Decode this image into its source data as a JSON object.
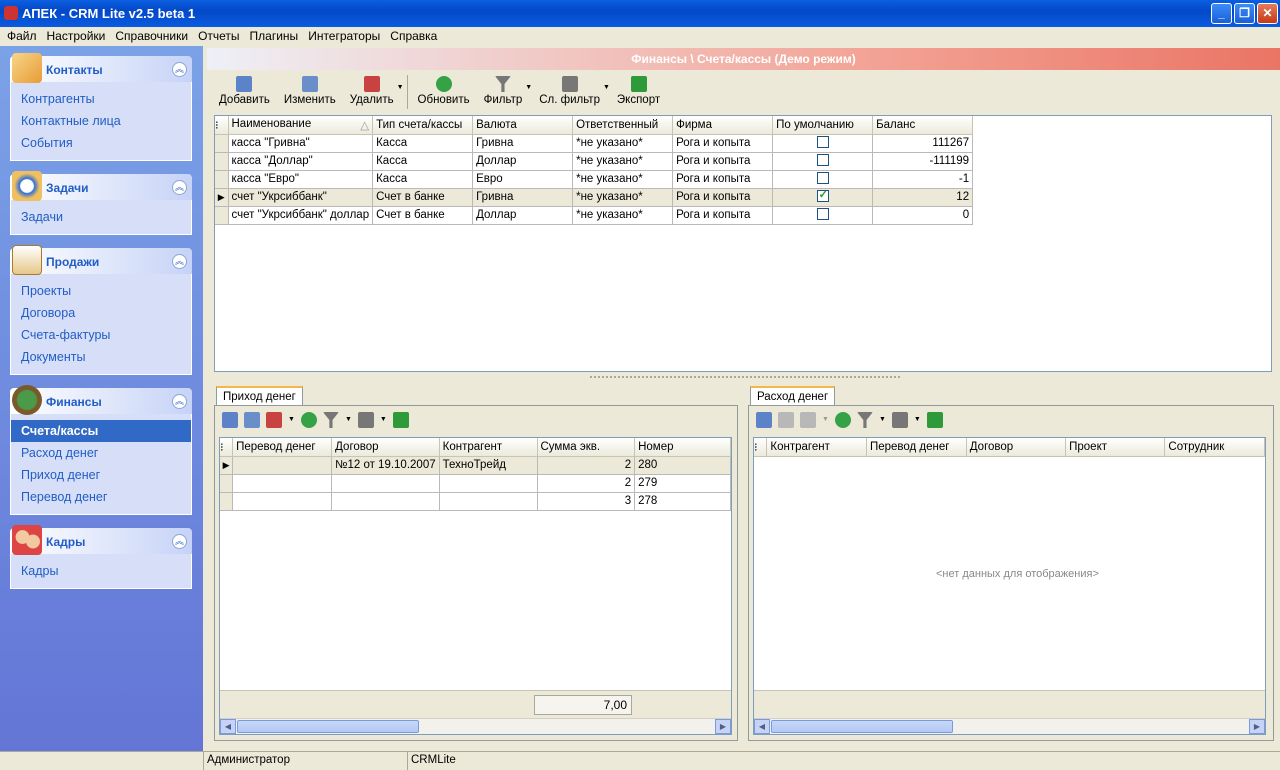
{
  "window": {
    "title": "АПЕК - CRM Lite v2.5 beta 1"
  },
  "menu": [
    "Файл",
    "Настройки",
    "Справочники",
    "Отчеты",
    "Плагины",
    "Интеграторы",
    "Справка"
  ],
  "sidebar": {
    "groups": [
      {
        "title": "Контакты",
        "icon": "contacts-icon",
        "items": [
          "Контрагенты",
          "Контактные лица",
          "События"
        ]
      },
      {
        "title": "Задачи",
        "icon": "tasks-clock-icon",
        "items": [
          "Задачи"
        ]
      },
      {
        "title": "Продажи",
        "icon": "sales-clipboard-icon",
        "items": [
          "Проекты",
          "Договора",
          "Счета-фактуры",
          "Документы"
        ]
      },
      {
        "title": "Финансы",
        "icon": "money-bag-icon",
        "items": [
          "Счета/кассы",
          "Расход денег",
          "Приход денег",
          "Перевод денег"
        ],
        "active": 0
      },
      {
        "title": "Кадры",
        "icon": "staff-people-icon",
        "items": [
          "Кадры"
        ]
      }
    ]
  },
  "header": {
    "title": "Финансы \\ Счета/кассы (Демо режим)"
  },
  "toolbar": {
    "items": [
      "Добавить",
      "Изменить",
      "Удалить",
      "Обновить",
      "Фильтр",
      "Сл. фильтр",
      "Экспорт"
    ]
  },
  "accounts": {
    "columns": [
      "Наименование",
      "Тип счета/кассы",
      "Валюта",
      "Ответственный",
      "Фирма",
      "По умолчанию",
      "Баланс"
    ],
    "rows": [
      {
        "name": "касса \"Гривна\"",
        "type": "Касса",
        "currency": "Гривна",
        "resp": "*не указано*",
        "firm": "Рога и копыта",
        "default": false,
        "balance": "111267"
      },
      {
        "name": "касса \"Доллар\"",
        "type": "Касса",
        "currency": "Доллар",
        "resp": "*не указано*",
        "firm": "Рога и копыта",
        "default": false,
        "balance": "-111199"
      },
      {
        "name": "касса \"Евро\"",
        "type": "Касса",
        "currency": "Евро",
        "resp": "*не указано*",
        "firm": "Рога и копыта",
        "default": false,
        "balance": "-1"
      },
      {
        "name": "счет \"Укрсиббанк\"",
        "type": "Счет в банке",
        "currency": "Гривна",
        "resp": "*не указано*",
        "firm": "Рога и копыта",
        "default": true,
        "balance": "12"
      },
      {
        "name": "счет \"Укрсиббанк\" доллар",
        "type": "Счет в банке",
        "currency": "Доллар",
        "resp": "*не указано*",
        "firm": "Рога и копыта",
        "default": false,
        "balance": "0"
      }
    ]
  },
  "income": {
    "tab": "Приход денег",
    "columns": [
      "Перевод денег",
      "Договор",
      "Контрагент",
      "Сумма экв.",
      "Номер"
    ],
    "rows": [
      {
        "transfer": "",
        "contract": "№12 от 19.10.2007",
        "partner": "ТехноТрейд",
        "sum": "2",
        "number": "280"
      },
      {
        "transfer": "",
        "contract": "",
        "partner": "",
        "sum": "2",
        "number": "279"
      },
      {
        "transfer": "",
        "contract": "",
        "partner": "",
        "sum": "3",
        "number": "278"
      }
    ],
    "total": "7,00"
  },
  "expense": {
    "tab": "Расход денег",
    "columns": [
      "Контрагент",
      "Перевод денег",
      "Договор",
      "Проект",
      "Сотрудник"
    ],
    "empty": "<нет данных для отображения>"
  },
  "status": {
    "user": "Администратор",
    "app": "CRMLite"
  }
}
